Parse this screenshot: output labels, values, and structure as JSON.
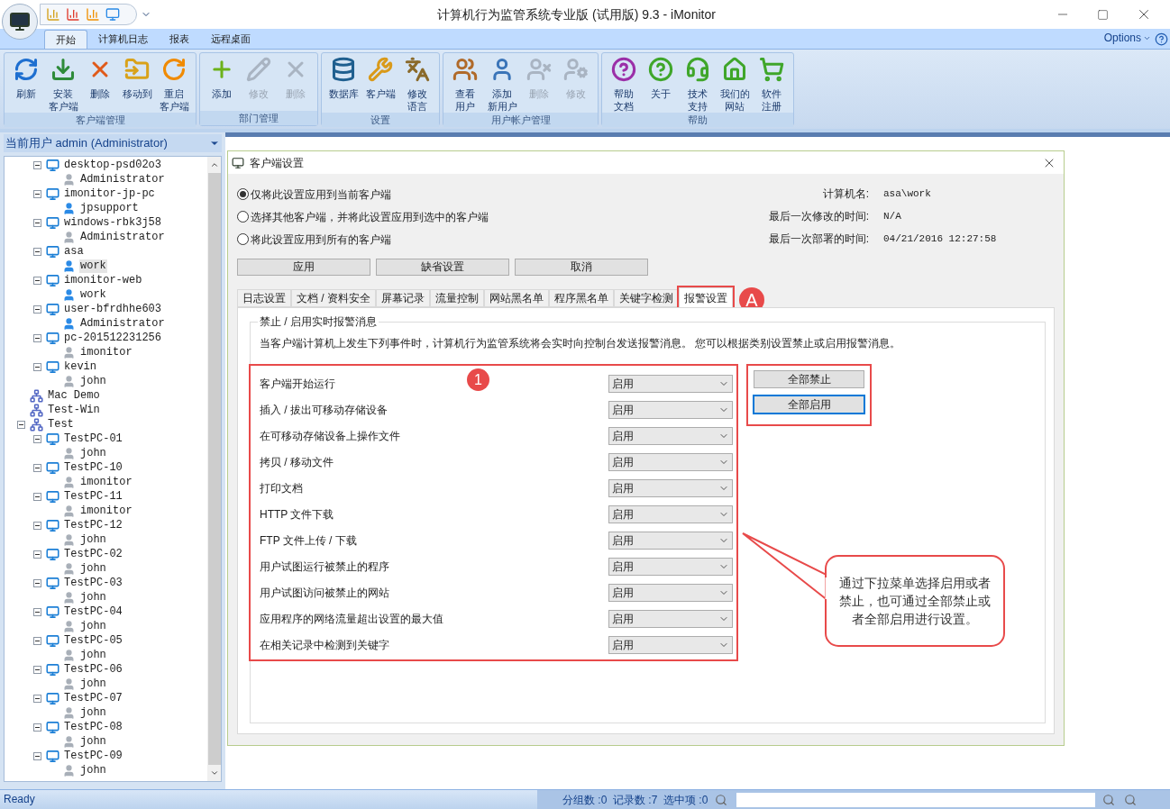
{
  "window": {
    "title": "计算机行为监管系统专业版 (试用版) 9.3 - iMonitor"
  },
  "ribbon": {
    "tabs": [
      {
        "label": "开始",
        "selected": true
      },
      {
        "label": "计算机日志",
        "selected": false
      },
      {
        "label": "报表",
        "selected": false
      },
      {
        "label": "远程桌面",
        "selected": false
      }
    ],
    "options": "Options",
    "groups": [
      {
        "title": "客户端管理",
        "buttons": [
          {
            "kind": "refresh",
            "lines": [
              "刷新"
            ],
            "disabled": false
          },
          {
            "kind": "install",
            "lines": [
              "安装",
              "客户端"
            ],
            "disabled": false
          },
          {
            "kind": "delete",
            "lines": [
              "删除"
            ],
            "disabled": false
          },
          {
            "kind": "move",
            "lines": [
              "移动到"
            ],
            "disabled": false
          },
          {
            "kind": "restart",
            "lines": [
              "重启",
              "客户端"
            ],
            "disabled": false
          }
        ]
      },
      {
        "title": "部门管理",
        "buttons": [
          {
            "kind": "add",
            "lines": [
              "添加"
            ],
            "disabled": false
          },
          {
            "kind": "edit",
            "lines": [
              "修改"
            ],
            "disabled": true
          },
          {
            "kind": "delete",
            "lines": [
              "删除"
            ],
            "disabled": true
          }
        ]
      },
      {
        "title": "设置",
        "buttons": [
          {
            "kind": "database",
            "lines": [
              "数据库"
            ],
            "disabled": false
          },
          {
            "kind": "client",
            "lines": [
              "客户端"
            ],
            "disabled": false
          },
          {
            "kind": "language",
            "lines": [
              "修改",
              "语言"
            ],
            "disabled": false
          }
        ]
      },
      {
        "title": "用户帐户管理",
        "buttons": [
          {
            "kind": "users",
            "lines": [
              "查看",
              "用户"
            ],
            "disabled": false
          },
          {
            "kind": "user",
            "lines": [
              "添加",
              "新用户"
            ],
            "disabled": false
          },
          {
            "kind": "user-delete",
            "lines": [
              "删除"
            ],
            "disabled": true
          },
          {
            "kind": "user-info",
            "lines": [
              "修改"
            ],
            "disabled": true
          }
        ]
      },
      {
        "title": "帮助",
        "buttons": [
          {
            "kind": "help",
            "lines": [
              "帮助",
              "文档"
            ],
            "disabled": false
          },
          {
            "kind": "about",
            "lines": [
              "关于"
            ],
            "disabled": false
          },
          {
            "kind": "support",
            "lines": [
              "技术",
              "支持"
            ],
            "disabled": false
          },
          {
            "kind": "home",
            "lines": [
              "我们的",
              "网站"
            ],
            "disabled": false
          },
          {
            "kind": "cart",
            "lines": [
              "软件",
              "注册"
            ],
            "disabled": false
          }
        ]
      }
    ]
  },
  "sidebar": {
    "current_user": "当前用户 admin (Administrator)",
    "tree_continued": [
      {
        "kind": "computer",
        "label": "desktop-psd02o3",
        "expanded": true,
        "children": [
          {
            "kind": "user",
            "label": "Administrator",
            "online": false,
            "selected": false
          }
        ]
      },
      {
        "kind": "computer",
        "label": "imonitor-jp-pc",
        "expanded": true,
        "children": [
          {
            "kind": "user",
            "label": "jpsupport",
            "online": true,
            "selected": false
          }
        ]
      },
      {
        "kind": "computer",
        "label": "windows-rbk3j58",
        "expanded": true,
        "children": [
          {
            "kind": "user",
            "label": "Administrator",
            "online": false,
            "selected": false
          }
        ]
      },
      {
        "kind": "computer",
        "label": "asa",
        "expanded": true,
        "children": [
          {
            "kind": "user",
            "label": "work",
            "online": true,
            "selected": true
          }
        ]
      },
      {
        "kind": "computer",
        "label": "imonitor-web",
        "expanded": true,
        "children": [
          {
            "kind": "user",
            "label": "work",
            "online": true,
            "selected": false
          }
        ]
      },
      {
        "kind": "computer",
        "label": "user-bfrdhhe603",
        "expanded": true,
        "children": [
          {
            "kind": "user",
            "label": "Administrator",
            "online": true,
            "selected": false
          }
        ]
      },
      {
        "kind": "computer",
        "label": "pc-201512231256",
        "expanded": true,
        "children": [
          {
            "kind": "user",
            "label": "imonitor",
            "online": false,
            "selected": false
          }
        ]
      },
      {
        "kind": "computer",
        "label": "kevin",
        "expanded": true,
        "children": [
          {
            "kind": "user",
            "label": "john",
            "online": false,
            "selected": false
          }
        ]
      }
    ],
    "tree": [
      {
        "kind": "group",
        "label": "Mac Demo"
      },
      {
        "kind": "group",
        "label": "Test-Win"
      },
      {
        "kind": "group",
        "label": "Test",
        "expanded": true,
        "children": [
          {
            "kind": "computer",
            "label": "TestPC-01",
            "expanded": true,
            "children": [
              {
                "kind": "user",
                "label": "john",
                "online": false,
                "selected": false
              }
            ]
          },
          {
            "kind": "computer",
            "label": "TestPC-10",
            "expanded": true,
            "children": [
              {
                "kind": "user",
                "label": "imonitor",
                "online": false,
                "selected": false
              }
            ]
          },
          {
            "kind": "computer",
            "label": "TestPC-11",
            "expanded": true,
            "children": [
              {
                "kind": "user",
                "label": "imonitor",
                "online": false,
                "selected": false
              }
            ]
          },
          {
            "kind": "computer",
            "label": "TestPC-12",
            "expanded": true,
            "children": [
              {
                "kind": "user",
                "label": "john",
                "online": false,
                "selected": false
              }
            ]
          },
          {
            "kind": "computer",
            "label": "TestPC-02",
            "expanded": true,
            "children": [
              {
                "kind": "user",
                "label": "john",
                "online": false,
                "selected": false
              }
            ]
          },
          {
            "kind": "computer",
            "label": "TestPC-03",
            "expanded": true,
            "children": [
              {
                "kind": "user",
                "label": "john",
                "online": false,
                "selected": false
              }
            ]
          },
          {
            "kind": "computer",
            "label": "TestPC-04",
            "expanded": true,
            "children": [
              {
                "kind": "user",
                "label": "john",
                "online": false,
                "selected": false
              }
            ]
          },
          {
            "kind": "computer",
            "label": "TestPC-05",
            "expanded": true,
            "children": [
              {
                "kind": "user",
                "label": "john",
                "online": false,
                "selected": false
              }
            ]
          },
          {
            "kind": "computer",
            "label": "TestPC-06",
            "expanded": true,
            "children": [
              {
                "kind": "user",
                "label": "john",
                "online": false,
                "selected": false
              }
            ]
          },
          {
            "kind": "computer",
            "label": "TestPC-07",
            "expanded": true,
            "children": [
              {
                "kind": "user",
                "label": "john",
                "online": false,
                "selected": false
              }
            ]
          },
          {
            "kind": "computer",
            "label": "TestPC-08",
            "expanded": true,
            "children": [
              {
                "kind": "user",
                "label": "john",
                "online": false,
                "selected": false
              }
            ]
          },
          {
            "kind": "computer",
            "label": "TestPC-09",
            "expanded": true,
            "children": [
              {
                "kind": "user",
                "label": "john",
                "online": false,
                "selected": false
              }
            ]
          }
        ]
      }
    ]
  },
  "dialog": {
    "title": "客户端设置",
    "scope_options": [
      {
        "label": "仅将此设置应用到当前客户端",
        "selected": true
      },
      {
        "label": "选择其他客户端，并将此设置应用到选中的客户端",
        "selected": false
      },
      {
        "label": "将此设置应用到所有的客户端",
        "selected": false
      }
    ],
    "info": [
      {
        "label": "计算机名:",
        "value": "asa\\work"
      },
      {
        "label": "最后一次修改的时间:",
        "value": "N/A"
      },
      {
        "label": "最后一次部署的时间:",
        "value": "04/21/2016 12:27:58"
      }
    ],
    "buttons": [
      "应用",
      "缺省设置",
      "取消"
    ],
    "tabs": [
      {
        "label": "日志设置",
        "selected": false,
        "highlighted": false
      },
      {
        "label": "文档 / 资料安全",
        "selected": false,
        "highlighted": false
      },
      {
        "label": "屏幕记录",
        "selected": false,
        "highlighted": false
      },
      {
        "label": "流量控制",
        "selected": false,
        "highlighted": false
      },
      {
        "label": "网站黑名单",
        "selected": false,
        "highlighted": false
      },
      {
        "label": "程序黑名单",
        "selected": false,
        "highlighted": false
      },
      {
        "label": "关键字检测",
        "selected": false,
        "highlighted": false
      },
      {
        "label": "报警设置",
        "selected": true,
        "highlighted": true
      }
    ],
    "group_title": "禁止 / 启用实时报警消息",
    "description": "当客户端计算机上发生下列事件时，计算机行为监管系统将会实时向控制台发送报警消息。 您可以根据类别设置禁止或启用报警消息。",
    "alerts": [
      {
        "label": "客户端开始运行",
        "value": "启用"
      },
      {
        "label": "插入 / 拔出可移动存储设备",
        "value": "启用"
      },
      {
        "label": "在可移动存储设备上操作文件",
        "value": "启用"
      },
      {
        "label": "拷贝 / 移动文件",
        "value": "启用"
      },
      {
        "label": "打印文档",
        "value": "启用"
      },
      {
        "label": "HTTP 文件下载",
        "value": "启用"
      },
      {
        "label": "FTP 文件上传 / 下载",
        "value": "启用"
      },
      {
        "label": "用户试图运行被禁止的程序",
        "value": "启用"
      },
      {
        "label": "用户试图访问被禁止的网站",
        "value": "启用"
      },
      {
        "label": "应用程序的网络流量超出设置的最大值",
        "value": "启用"
      },
      {
        "label": "在相关记录中检测到关键字",
        "value": "启用"
      }
    ],
    "bulk_buttons": [
      {
        "label": "全部禁止",
        "focused": false
      },
      {
        "label": "全部启用",
        "focused": true
      }
    ]
  },
  "annotations": {
    "tab_marker": "A",
    "list_marker": "1",
    "callout": "通过下拉菜单选择启用或者禁止，也可通过全部禁止或者全部启用进行设置。"
  },
  "status_bar": {
    "text": "Ready",
    "counts": "分组数 :0  记录数 :7  选中项 :0"
  }
}
